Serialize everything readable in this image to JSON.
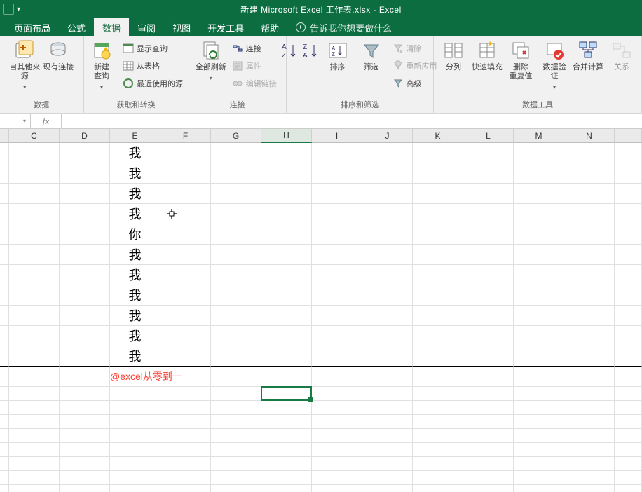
{
  "title": "新建 Microsoft Excel 工作表.xlsx  -  Excel",
  "tabs": {
    "layout": "页面布局",
    "formulas": "公式",
    "data": "数据",
    "review": "审阅",
    "view": "视图",
    "dev": "开发工具",
    "help": "帮助",
    "tell": "告诉我你想要做什么"
  },
  "ribbon": {
    "g1": {
      "b1": "自其他来源",
      "b2": "现有连接",
      "label": "数据"
    },
    "g2": {
      "b": "新建\n查询",
      "m1": "显示查询",
      "m2": "从表格",
      "m3": "最近使用的源",
      "label": "获取和转换"
    },
    "g3": {
      "b": "全部刷新",
      "m1": "连接",
      "m2": "属性",
      "m3": "编辑链接",
      "label": "连接"
    },
    "g4": {
      "b1": "",
      "b2": "",
      "b3": "排序",
      "b4": "筛选",
      "m1": "清除",
      "m2": "重新应用",
      "m3": "高级",
      "label": "排序和筛选"
    },
    "g5": {
      "b1": "分列",
      "b2": "快速填充",
      "b3": "删除\n重复值",
      "b4": "数据验\n证",
      "b5": "合并计算",
      "b6": "关系",
      "label": "数据工具"
    }
  },
  "fx_label": "fx",
  "columns": [
    "C",
    "D",
    "E",
    "F",
    "G",
    "H",
    "I",
    "J",
    "K",
    "L",
    "M",
    "N"
  ],
  "col_widths": {
    "part": 13,
    "std": 72
  },
  "cells": {
    "E1": "我",
    "E2": "我",
    "E3": "我",
    "E4": "我",
    "E5": "你",
    "E6": "我",
    "E7": "我",
    "E8": "我",
    "E9": "我",
    "E10": "我",
    "E11": "我"
  },
  "note": "@excel从零到一",
  "active_cell_index": {
    "col": 5,
    "row": 11
  }
}
